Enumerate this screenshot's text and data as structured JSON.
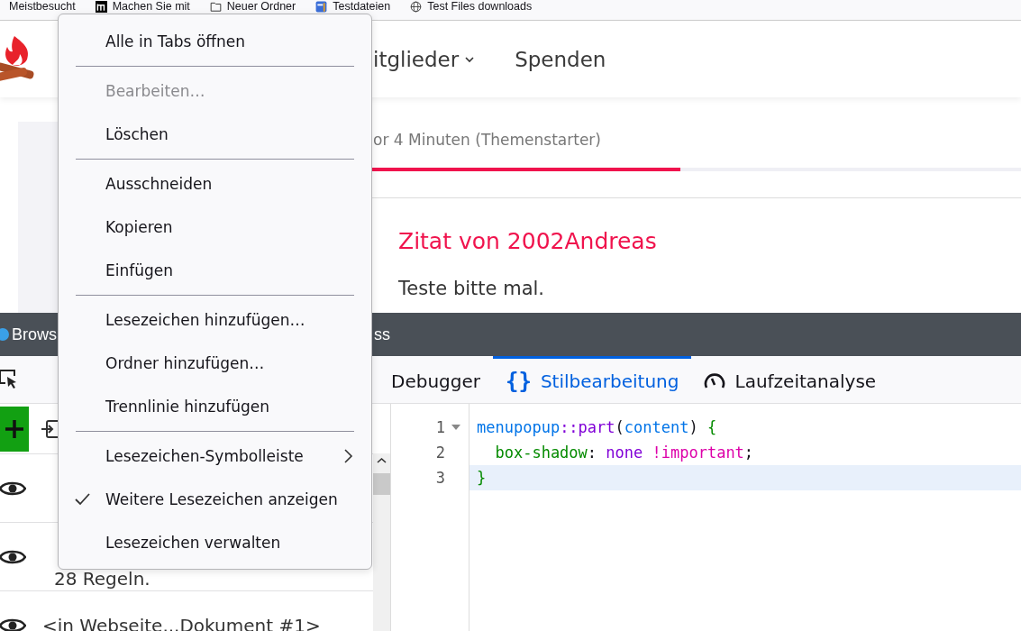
{
  "bookmarks_bar": [
    {
      "label": "Meistbesucht",
      "kind": "none"
    },
    {
      "label": "Machen Sie mit",
      "kind": "logo"
    },
    {
      "label": "Neuer Ordner",
      "kind": "folder"
    },
    {
      "label": "Testdateien",
      "kind": "app"
    },
    {
      "label": "Test Files downloads",
      "kind": "globe"
    }
  ],
  "site_nav": [
    {
      "label": "itglieder",
      "dropdown": true
    },
    {
      "label": "Spenden",
      "dropdown": false
    }
  ],
  "post_tabs": [
    {
      "label": "or 4 Minuten (Themenstarter)",
      "selected": true
    }
  ],
  "quote": {
    "title": "Zitat von 2002Andreas",
    "text": "Teste bitte mal."
  },
  "devtools": {
    "title_left": "Brows",
    "title_right": "ss",
    "tabs": [
      {
        "label": "Debugger",
        "kind": "plain",
        "selected": false
      },
      {
        "label": "Stilbearbeitung",
        "kind": "braces",
        "icon_text": "{}",
        "selected": true
      },
      {
        "label": "Laufzeitanalyse",
        "kind": "gauge",
        "selected": false
      }
    ],
    "style_sheets": [
      {
        "visible": true
      },
      {
        "visible": true,
        "rules": "28 Regeln."
      },
      {
        "visible": true,
        "name": "<in Webseite...Dokument #1>"
      }
    ],
    "editor_lines": [
      {
        "number": "1",
        "foldable": true,
        "current": false,
        "tokens": [
          {
            "text": "menupopup",
            "kind": "selector"
          },
          {
            "text": "::part",
            "kind": "pseudo"
          },
          {
            "text": "(",
            "kind": "plain"
          },
          {
            "text": "content",
            "kind": "selector"
          },
          {
            "text": ")",
            "kind": "plain"
          },
          {
            "text": " {",
            "kind": "brace"
          }
        ]
      },
      {
        "number": "2",
        "foldable": false,
        "current": false,
        "tokens": [
          {
            "text": "  box-shadow",
            "kind": "property"
          },
          {
            "text": ": ",
            "kind": "plain"
          },
          {
            "text": "none",
            "kind": "pseudo"
          },
          {
            "text": " !important",
            "kind": "important"
          },
          {
            "text": ";",
            "kind": "plain"
          }
        ]
      },
      {
        "number": "3",
        "foldable": false,
        "current": true,
        "tokens": [
          {
            "text": "}",
            "kind": "brace"
          }
        ]
      }
    ]
  },
  "context_menu": [
    {
      "kind": "item",
      "label": "Alle in Tabs öffnen",
      "disabled": false,
      "checked": false,
      "submenu": false
    },
    {
      "kind": "separator"
    },
    {
      "kind": "item",
      "label": "Bearbeiten…",
      "disabled": true,
      "checked": false,
      "submenu": false
    },
    {
      "kind": "item",
      "label": "Löschen",
      "disabled": false,
      "checked": false,
      "submenu": false
    },
    {
      "kind": "separator"
    },
    {
      "kind": "item",
      "label": "Ausschneiden",
      "disabled": false,
      "checked": false,
      "submenu": false
    },
    {
      "kind": "item",
      "label": "Kopieren",
      "disabled": false,
      "checked": false,
      "submenu": false
    },
    {
      "kind": "item",
      "label": "Einfügen",
      "disabled": false,
      "checked": false,
      "submenu": false
    },
    {
      "kind": "separator"
    },
    {
      "kind": "item",
      "label": "Lesezeichen hinzufügen…",
      "disabled": false,
      "checked": false,
      "submenu": false
    },
    {
      "kind": "item",
      "label": "Ordner hinzufügen…",
      "disabled": false,
      "checked": false,
      "submenu": false
    },
    {
      "kind": "item",
      "label": "Trennlinie hinzufügen",
      "disabled": false,
      "checked": false,
      "submenu": false
    },
    {
      "kind": "separator"
    },
    {
      "kind": "item",
      "label": "Lesezeichen-Symbolleiste",
      "disabled": false,
      "checked": false,
      "submenu": true
    },
    {
      "kind": "item",
      "label": "Weitere Lesezeichen anzeigen",
      "disabled": false,
      "checked": true,
      "submenu": false
    },
    {
      "kind": "item",
      "label": "Lesezeichen verwalten",
      "disabled": false,
      "checked": false,
      "submenu": false
    }
  ]
}
